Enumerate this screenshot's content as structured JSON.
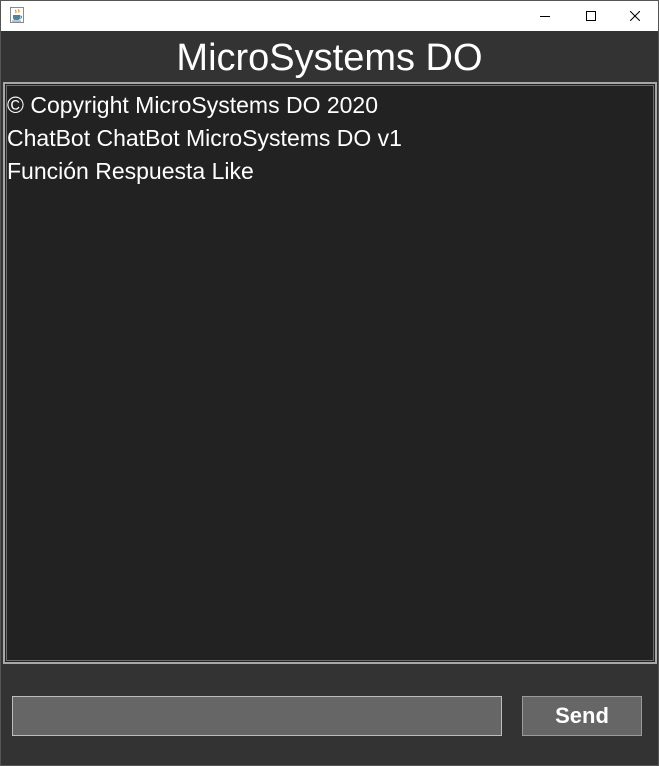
{
  "window": {
    "title_icon": "java-cup-icon",
    "controls": {
      "minimize_icon": "minimize-icon",
      "maximize_icon": "maximize-icon",
      "close_icon": "close-icon"
    }
  },
  "header": {
    "title": "MicroSystems DO"
  },
  "chat": {
    "lines": [
      "© Copyright MicroSystems DO 2020",
      "ChatBot ChatBot MicroSystems DO v1",
      "Función Respuesta Like"
    ]
  },
  "composer": {
    "input_value": "",
    "send_label": "Send"
  },
  "colors": {
    "background": "#333333",
    "chat_background": "#222222",
    "control_background": "#666666",
    "text": "#ffffff"
  }
}
